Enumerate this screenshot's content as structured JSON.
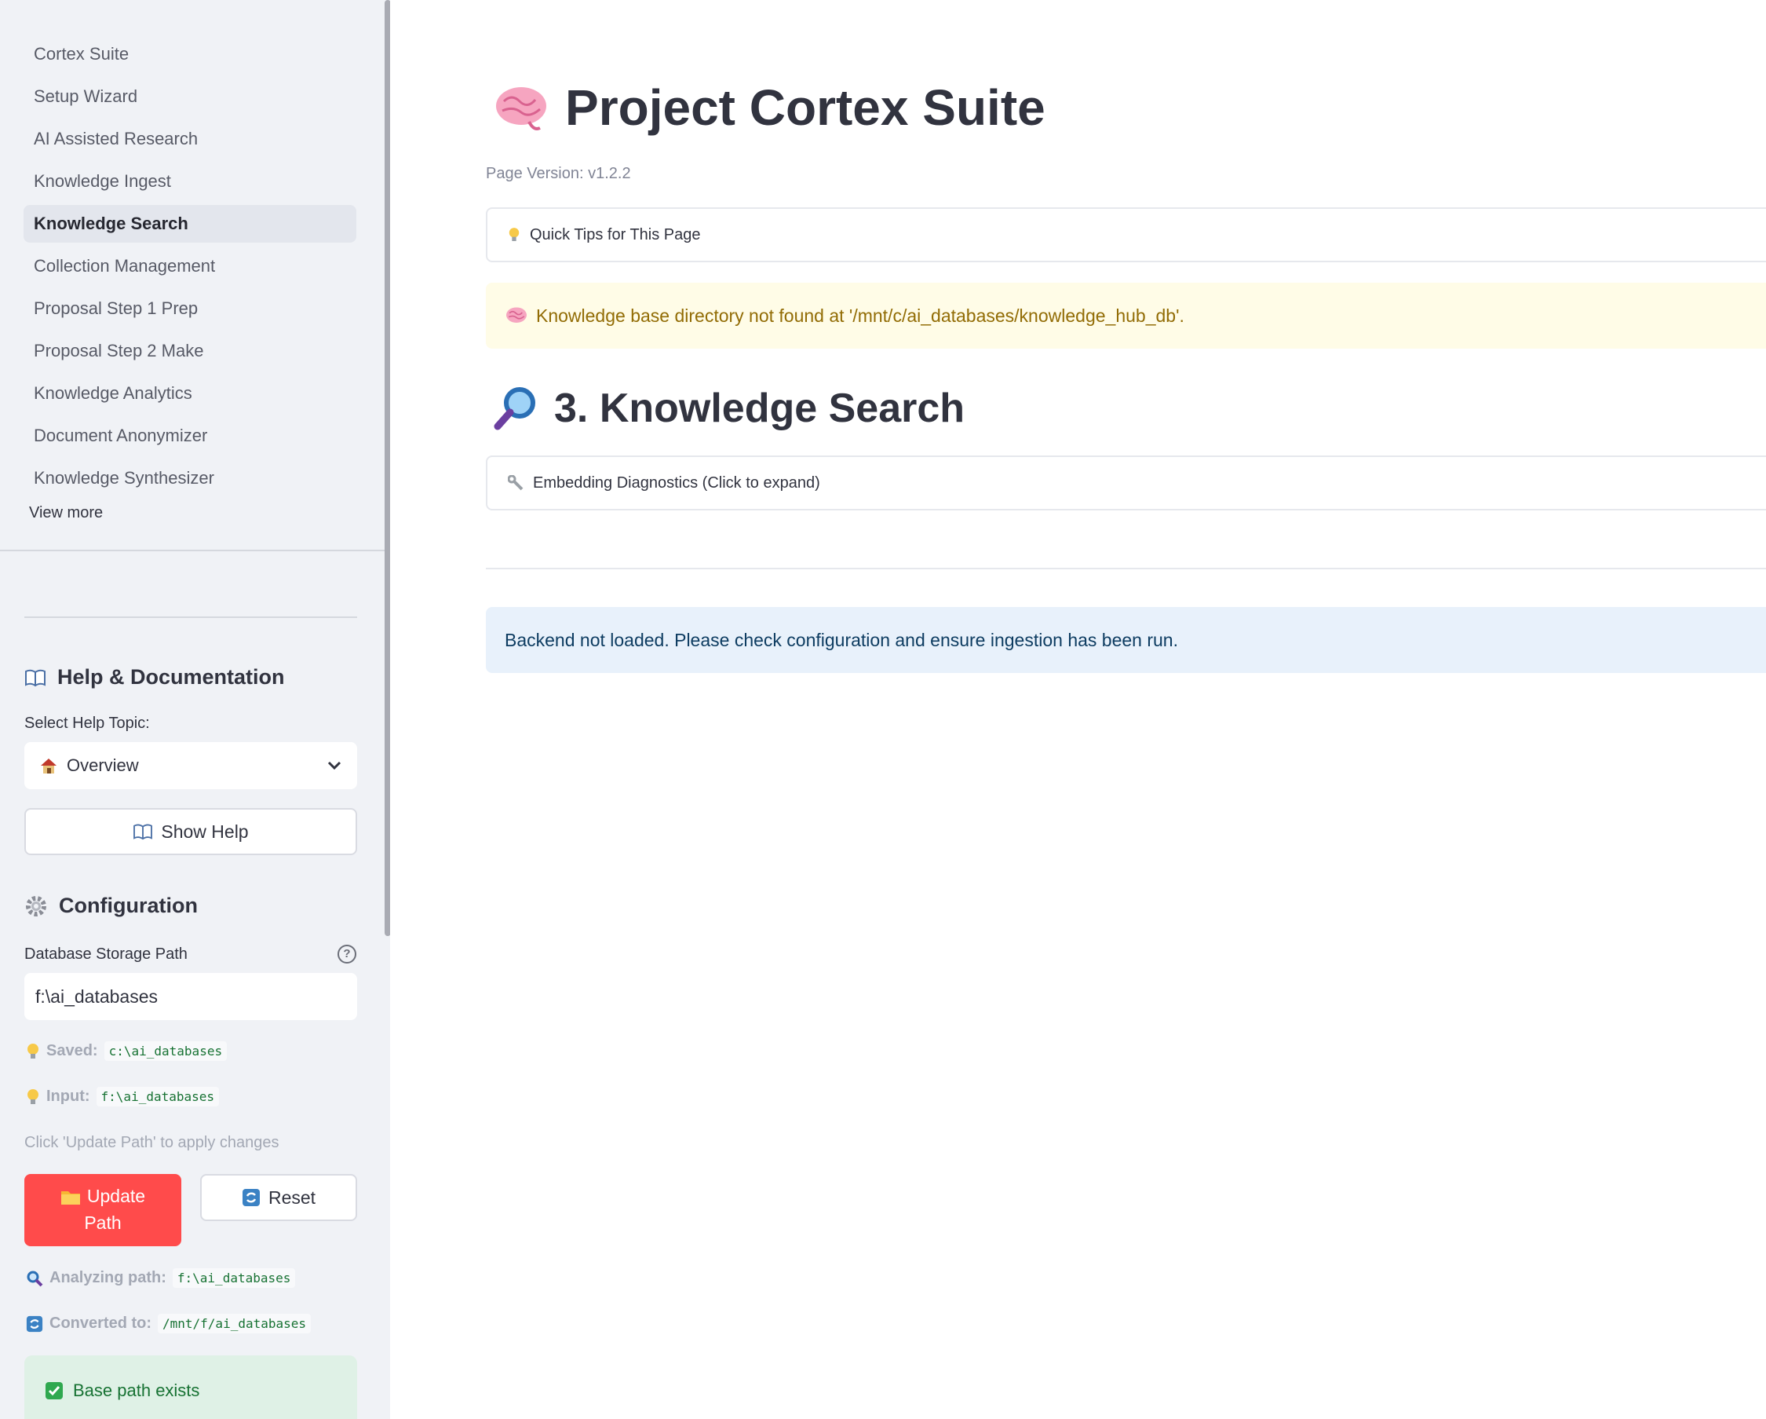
{
  "sidebar": {
    "nav_items": [
      {
        "label": "Cortex Suite",
        "active": false
      },
      {
        "label": "Setup Wizard",
        "active": false
      },
      {
        "label": "AI Assisted Research",
        "active": false
      },
      {
        "label": "Knowledge Ingest",
        "active": false
      },
      {
        "label": "Knowledge Search",
        "active": true
      },
      {
        "label": "Collection Management",
        "active": false
      },
      {
        "label": "Proposal Step 1 Prep",
        "active": false
      },
      {
        "label": "Proposal Step 2 Make",
        "active": false
      },
      {
        "label": "Knowledge Analytics",
        "active": false
      },
      {
        "label": "Document Anonymizer",
        "active": false
      },
      {
        "label": "Knowledge Synthesizer",
        "active": false
      }
    ],
    "view_more": "View more",
    "help": {
      "heading": "Help & Documentation",
      "heading_icon": "book-icon",
      "select_label": "Select Help Topic:",
      "selected_topic": "Overview",
      "selected_topic_icon": "house-icon",
      "show_help_label": "Show Help"
    },
    "config": {
      "heading": "Configuration",
      "heading_icon": "gear-icon",
      "db_path_label": "Database Storage Path",
      "db_path_value": "f:\\ai_databases",
      "saved_label": "Saved:",
      "saved_value": "c:\\ai_databases",
      "input_label": "Input:",
      "input_value": "f:\\ai_databases",
      "hint": "Click 'Update Path' to apply changes",
      "update_button_line1": "Update",
      "update_button_line2": "Path",
      "reset_button": "Reset",
      "analyzing_label": "Analyzing path:",
      "analyzing_value": "f:\\ai_databases",
      "converted_label": "Converted to:",
      "converted_value": "/mnt/f/ai_databases",
      "success_text": "Base path exists"
    }
  },
  "main": {
    "title": "Project Cortex Suite",
    "title_icon": "brain-icon",
    "page_version": "Page Version: v1.2.2",
    "quick_tips": "Quick Tips for This Page",
    "warning": "Knowledge base directory not found at '/mnt/c/ai_databases/knowledge_hub_db'.",
    "section_title": "3. Knowledge Search",
    "section_icon": "magnifier-icon",
    "embedding_diagnostics": "Embedding Diagnostics (Click to expand)",
    "info": "Backend not loaded. Please check configuration and ensure ingestion has been run."
  },
  "colors": {
    "sidebar_bg": "#f0f2f6",
    "primary": "#ff4b4b",
    "warning_bg": "#fffce7",
    "warning_text": "#926c05",
    "info_bg": "#e8f1fb",
    "info_text": "#0d3c61",
    "success_bg": "#dff1e6",
    "success_text": "#177233"
  }
}
